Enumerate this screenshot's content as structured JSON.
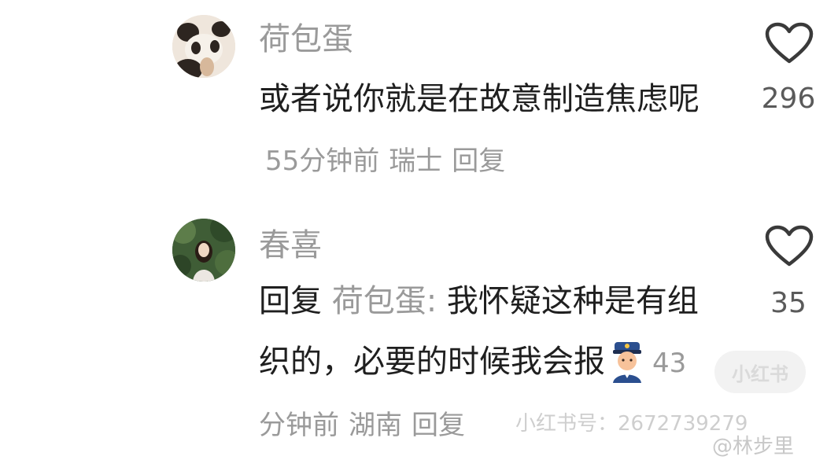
{
  "comments": [
    {
      "username": "荷包蛋",
      "text": "或者说你就是在故意制造焦虑呢",
      "time": "55分钟前",
      "location": "瑞士",
      "reply_label": "回复",
      "likes": "296"
    },
    {
      "username": "春喜",
      "reply_prefix": "回复",
      "reply_to": "荷包蛋:",
      "text": "我怀疑这种是有组织的，必要的时候我会报",
      "emoji": "police-officer-emoji",
      "time": "43分钟前",
      "location": "湖南",
      "reply_label": "回复",
      "likes": "35"
    }
  ],
  "watermark": {
    "app": "小红书",
    "id_text": "小红书号：2672739279",
    "weibo_user": "@林步里"
  },
  "colors": {
    "text": "#1f1f1f",
    "meta": "#9a9a9a",
    "like_count": "#5a5a5a"
  }
}
